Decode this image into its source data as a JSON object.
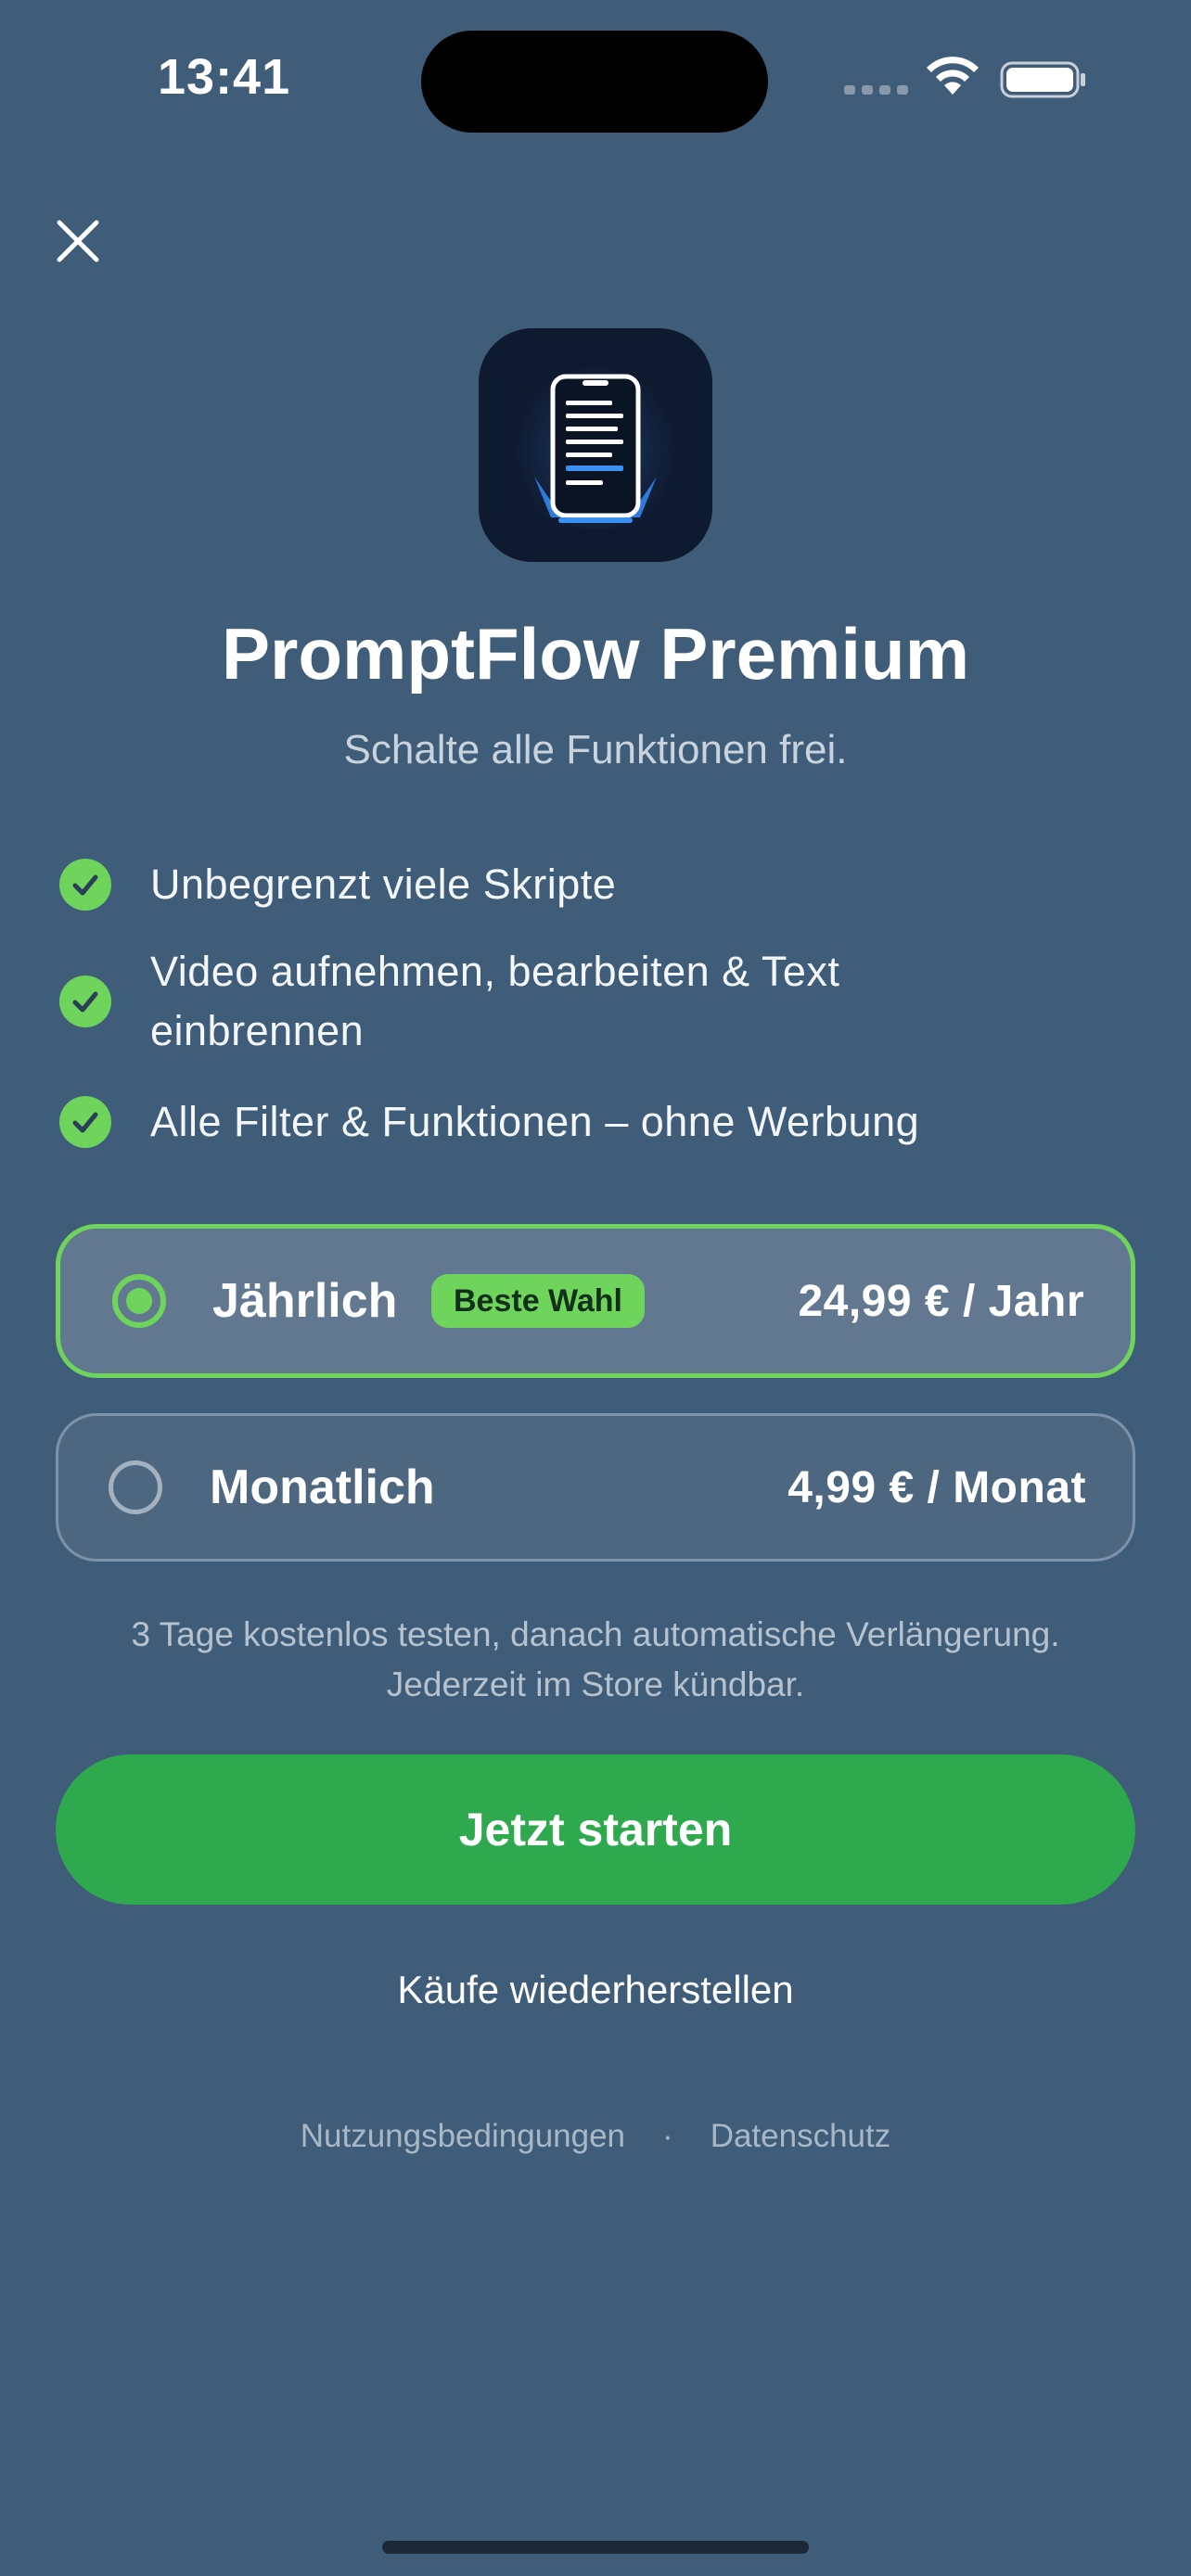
{
  "status_bar": {
    "time": "13:41"
  },
  "icons": {
    "close": "close-icon",
    "check": "checkmark-icon",
    "wifi": "wifi-icon",
    "battery": "battery-icon",
    "app": "script-phone-app-icon"
  },
  "header": {
    "title": "PromptFlow Premium",
    "subtitle": "Schalte alle Funktionen frei."
  },
  "features": [
    {
      "text": "Unbegrenzt viele Skripte"
    },
    {
      "line1": "Video aufnehmen, bearbeiten & Text",
      "line2": "einbrennen"
    },
    {
      "text": "Alle Filter & Funktionen – ohne Werbung"
    }
  ],
  "plans": {
    "yearly": {
      "label": "Jährlich",
      "badge": "Beste Wahl",
      "price": "24,99 € / Jahr",
      "selected": true
    },
    "monthly": {
      "label": "Monatlich",
      "price": "4,99 € / Monat",
      "selected": false
    }
  },
  "note": {
    "line1": "3 Tage kostenlos testen, danach automatische Verlängerung.",
    "line2": "Jederzeit im Store kündbar."
  },
  "cta_label": "Jetzt starten",
  "restore_label": "Käufe wiederherstellen",
  "legal": {
    "terms": "Nutzungsbedingungen",
    "separator": "·",
    "privacy": "Datenschutz"
  },
  "colors": {
    "background": "#3f5c78",
    "accent_green": "#6fd45c",
    "cta_green": "#2fa94e",
    "selected_plan_bg": "#617890",
    "plan_bg": "#4d6781"
  }
}
